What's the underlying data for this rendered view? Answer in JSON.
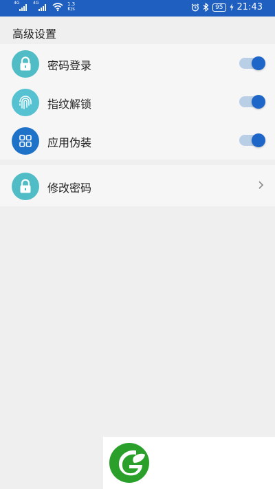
{
  "status_bar": {
    "sim1_tag": "4G",
    "sim2_tag": "4G",
    "speed_value": "1.3",
    "speed_unit": "K/s",
    "battery": "95",
    "time": "21:43"
  },
  "section_title": "高级设置",
  "settings": [
    {
      "label": "密码登录",
      "icon": "lock-icon",
      "icon_color": "#4fbcc6",
      "enabled": true
    },
    {
      "label": "指纹解锁",
      "icon": "fingerprint-icon",
      "icon_color": "#56c1d0",
      "enabled": true
    },
    {
      "label": "应用伪装",
      "icon": "grid-icon",
      "icon_color": "#1e72c8",
      "enabled": true
    }
  ],
  "change_password": {
    "label": "修改密码",
    "icon": "lock-icon",
    "icon_color": "#4fbcc6"
  },
  "colors": {
    "status_bar": "#1e5fc0",
    "toggle_knob": "#1e67c8",
    "toggle_track": "#b9cfe6",
    "logo_green": "#2aa02a"
  }
}
